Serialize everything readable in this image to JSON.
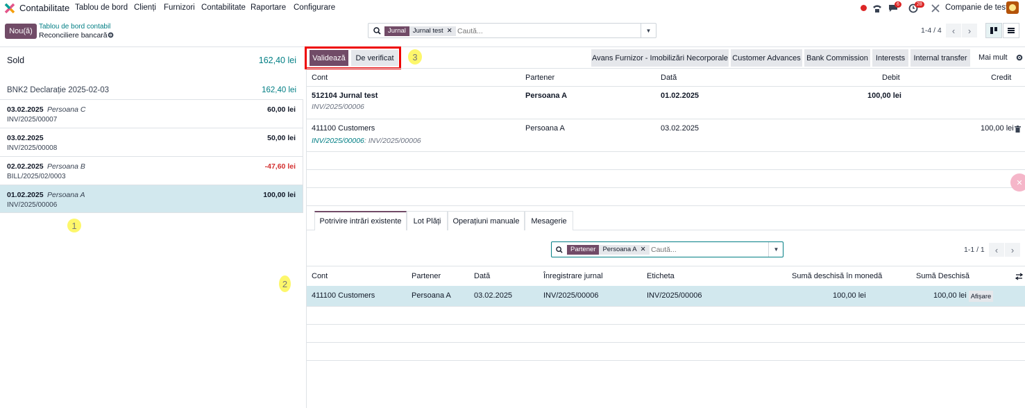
{
  "nav": {
    "app_name": "Contabilitate",
    "menu": [
      "Tablou de bord",
      "Clienți",
      "Furnizori",
      "Contabilitate",
      "Raportare",
      "Configurare"
    ],
    "company": "Companie de test",
    "messages_count": "6",
    "activities_count": "28",
    "colors": {
      "brand": "#714b67",
      "accent": "#017e84",
      "danger": "#dc2626"
    }
  },
  "control": {
    "new_button": "Nou(ă)",
    "breadcrumb_parent": "Tablou de bord contabil",
    "breadcrumb_current": "Reconciliere bancară",
    "search": {
      "facet_label": "Jurnal",
      "facet_value": "Jurnal test",
      "placeholder": "Caută..."
    },
    "pager": "1-4 / 4"
  },
  "left": {
    "sold_label": "Sold",
    "sold_value": "162,40 lei",
    "statement_name": "BNK2 Declarație 2025-02-03",
    "statement_value": "162,40 lei",
    "lines": [
      {
        "date": "03.02.2025",
        "partner": "Persoana C",
        "ref": "INV/2025/00007",
        "amount": "60,00 lei"
      },
      {
        "date": "03.02.2025",
        "partner": "",
        "ref": "INV/2025/00008",
        "amount": "50,00 lei"
      },
      {
        "date": "02.02.2025",
        "partner": "Persoana B",
        "ref": "BILL/2025/02/0003",
        "amount": "-47,60 lei"
      },
      {
        "date": "01.02.2025",
        "partner": "Persoana A",
        "ref": "INV/2025/00006",
        "amount": "100,00 lei"
      }
    ]
  },
  "annotations": {
    "m1": "1",
    "m2": "2",
    "m3": "3"
  },
  "right": {
    "validate": "Validează",
    "to_check": "De verificat",
    "models": [
      "Avans Furnizor - Imobilizări Necorporale",
      "Customer Advances",
      "Bank Commission",
      "Interests",
      "Internal transfer",
      "Mai mult"
    ],
    "headers": {
      "account": "Cont",
      "partner": "Partener",
      "date": "Dată",
      "debit": "Debit",
      "credit": "Credit"
    },
    "row1": {
      "account": "512104 Jurnal test",
      "label": "INV/2025/00006",
      "partner": "Persoana A",
      "date": "01.02.2025",
      "debit": "100,00 lei"
    },
    "row2": {
      "account": "411100 Customers",
      "link": "INV/2025/00006",
      "label": ": INV/2025/00006",
      "partner": "Persoana A",
      "date": "03.02.2025",
      "credit": "100,00 lei"
    },
    "tabs": [
      "Potrivire intrări existente",
      "Lot Plăți",
      "Operațiuni manuale",
      "Mesagerie"
    ],
    "search2": {
      "facet_label": "Partener",
      "facet_value": "Persoana A",
      "placeholder": "Caută..."
    },
    "pager2": "1-1 / 1",
    "amls_headers": {
      "account": "Cont",
      "partner": "Partener",
      "date": "Dată",
      "move": "Înregistrare jurnal",
      "label": "Eticheta",
      "residual_currency": "Sumă deschisă în monedă",
      "residual": "Sumă Deschisă"
    },
    "amls_row": {
      "account": "411100 Customers",
      "partner": "Persoana A",
      "date": "03.02.2025",
      "move": "INV/2025/00006",
      "label": "INV/2025/00006",
      "residual_currency": "100,00 lei",
      "residual": "100,00 lei",
      "show": "Afișare"
    }
  }
}
